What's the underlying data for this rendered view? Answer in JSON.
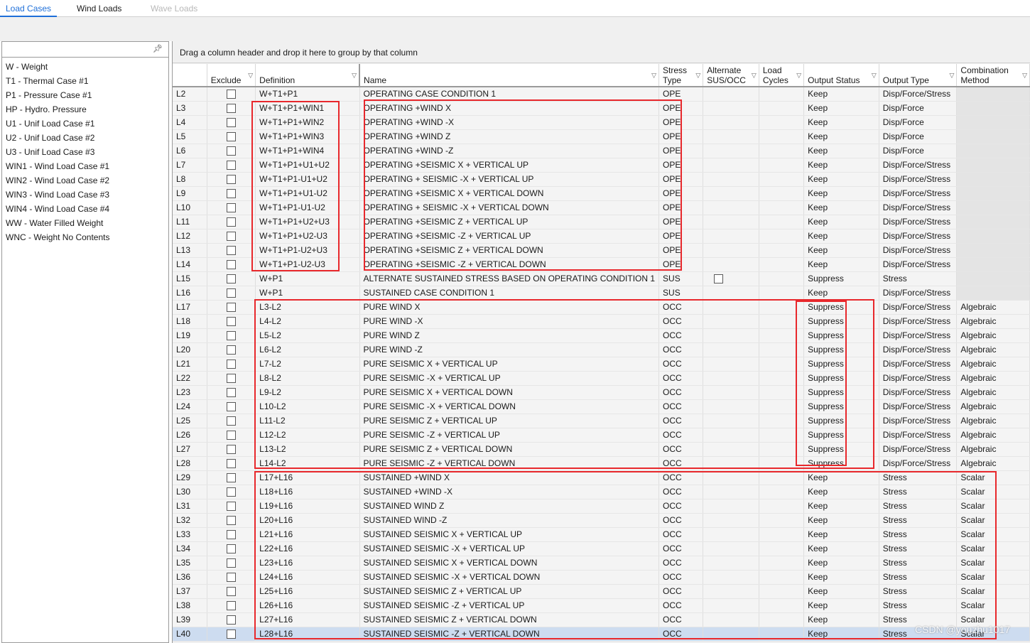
{
  "tabs": [
    {
      "label": "Load Cases",
      "state": "active"
    },
    {
      "label": "Wind Loads",
      "state": "normal"
    },
    {
      "label": "Wave Loads",
      "state": "disabled"
    }
  ],
  "left_list": [
    "W - Weight",
    "T1 - Thermal Case #1",
    "P1 - Pressure Case #1",
    "HP - Hydro. Pressure",
    "U1 - Unif Load Case #1",
    "U2 - Unif Load Case #2",
    "U3 - Unif Load Case #3",
    "WIN1 - Wind Load Case #1",
    "WIN2 - Wind Load Case #2",
    "WIN3 - Wind Load Case #3",
    "WIN4 - Wind Load Case #4",
    "WW - Water Filled Weight",
    "WNC - Weight No Contents"
  ],
  "group_panel": "Drag a column header and drop it here to group by that column",
  "columns": [
    {
      "key": "id",
      "label": "",
      "filter": false
    },
    {
      "key": "exclude",
      "label": "Exclude",
      "filter": true
    },
    {
      "key": "definition",
      "label": "Definition",
      "filter": true
    },
    {
      "key": "name",
      "label": "Name",
      "filter": true
    },
    {
      "key": "stress",
      "label": "Stress\nType",
      "filter": true
    },
    {
      "key": "alt",
      "label": "Alternate\nSUS/OCC",
      "filter": true
    },
    {
      "key": "cycles",
      "label": "Load\nCycles",
      "filter": true
    },
    {
      "key": "output",
      "label": "Output Status",
      "filter": true
    },
    {
      "key": "otype",
      "label": "Output Type",
      "filter": true
    },
    {
      "key": "comb",
      "label": "Combination\nMethod",
      "filter": true
    }
  ],
  "rows": [
    [
      "L2",
      "W+T1+P1",
      "OPERATING CASE CONDITION 1",
      "OPE",
      "Keep",
      "Disp/Force/Stress",
      ""
    ],
    [
      "L3",
      "W+T1+P1+WIN1",
      "OPERATING +WIND X",
      "OPE",
      "Keep",
      "Disp/Force",
      ""
    ],
    [
      "L4",
      "W+T1+P1+WIN2",
      "OPERATING +WIND -X",
      "OPE",
      "Keep",
      "Disp/Force",
      ""
    ],
    [
      "L5",
      "W+T1+P1+WIN3",
      "OPERATING +WIND Z",
      "OPE",
      "Keep",
      "Disp/Force",
      ""
    ],
    [
      "L6",
      "W+T1+P1+WIN4",
      "OPERATING +WIND -Z",
      "OPE",
      "Keep",
      "Disp/Force",
      ""
    ],
    [
      "L7",
      "W+T1+P1+U1+U2",
      "OPERATING +SEISMIC X + VERTICAL UP",
      "OPE",
      "Keep",
      "Disp/Force/Stress",
      ""
    ],
    [
      "L8",
      "W+T1+P1-U1+U2",
      "OPERATING + SEISMIC -X + VERTICAL UP",
      "OPE",
      "Keep",
      "Disp/Force/Stress",
      ""
    ],
    [
      "L9",
      "W+T1+P1+U1-U2",
      "OPERATING +SEISMIC X + VERTICAL DOWN",
      "OPE",
      "Keep",
      "Disp/Force/Stress",
      ""
    ],
    [
      "L10",
      "W+T1+P1-U1-U2",
      "OPERATING + SEISMIC -X + VERTICAL DOWN",
      "OPE",
      "Keep",
      "Disp/Force/Stress",
      ""
    ],
    [
      "L11",
      "W+T1+P1+U2+U3",
      "OPERATING +SEISMIC Z + VERTICAL UP",
      "OPE",
      "Keep",
      "Disp/Force/Stress",
      ""
    ],
    [
      "L12",
      "W+T1+P1+U2-U3",
      "OPERATING +SEISMIC -Z + VERTICAL UP",
      "OPE",
      "Keep",
      "Disp/Force/Stress",
      ""
    ],
    [
      "L13",
      "W+T1+P1-U2+U3",
      "OPERATING +SEISMIC Z + VERTICAL DOWN",
      "OPE",
      "Keep",
      "Disp/Force/Stress",
      ""
    ],
    [
      "L14",
      "W+T1+P1-U2-U3",
      "OPERATING +SEISMIC -Z + VERTICAL DOWN",
      "OPE",
      "Keep",
      "Disp/Force/Stress",
      ""
    ],
    [
      "L15",
      "W+P1",
      "ALTERNATE SUSTAINED STRESS BASED ON OPERATING CONDITION 1",
      "SUS",
      "Suppress",
      "Stress",
      ""
    ],
    [
      "L16",
      "W+P1",
      "SUSTAINED CASE CONDITION 1",
      "SUS",
      "Keep",
      "Disp/Force/Stress",
      ""
    ],
    [
      "L17",
      "L3-L2",
      "PURE WIND X",
      "OCC",
      "Suppress",
      "Disp/Force/Stress",
      "Algebraic"
    ],
    [
      "L18",
      "L4-L2",
      "PURE WIND -X",
      "OCC",
      "Suppress",
      "Disp/Force/Stress",
      "Algebraic"
    ],
    [
      "L19",
      "L5-L2",
      "PURE WIND Z",
      "OCC",
      "Suppress",
      "Disp/Force/Stress",
      "Algebraic"
    ],
    [
      "L20",
      "L6-L2",
      "PURE WIND -Z",
      "OCC",
      "Suppress",
      "Disp/Force/Stress",
      "Algebraic"
    ],
    [
      "L21",
      "L7-L2",
      "PURE SEISMIC X + VERTICAL UP",
      "OCC",
      "Suppress",
      "Disp/Force/Stress",
      "Algebraic"
    ],
    [
      "L22",
      "L8-L2",
      "PURE SEISMIC -X + VERTICAL UP",
      "OCC",
      "Suppress",
      "Disp/Force/Stress",
      "Algebraic"
    ],
    [
      "L23",
      "L9-L2",
      "PURE SEISMIC X + VERTICAL DOWN",
      "OCC",
      "Suppress",
      "Disp/Force/Stress",
      "Algebraic"
    ],
    [
      "L24",
      "L10-L2",
      "PURE SEISMIC -X + VERTICAL DOWN",
      "OCC",
      "Suppress",
      "Disp/Force/Stress",
      "Algebraic"
    ],
    [
      "L25",
      "L11-L2",
      "PURE SEISMIC Z + VERTICAL UP",
      "OCC",
      "Suppress",
      "Disp/Force/Stress",
      "Algebraic"
    ],
    [
      "L26",
      "L12-L2",
      "PURE SEISMIC -Z + VERTICAL UP",
      "OCC",
      "Suppress",
      "Disp/Force/Stress",
      "Algebraic"
    ],
    [
      "L27",
      "L13-L2",
      "PURE SEISMIC Z + VERTICAL DOWN",
      "OCC",
      "Suppress",
      "Disp/Force/Stress",
      "Algebraic"
    ],
    [
      "L28",
      "L14-L2",
      "PURE SEISMIC -Z + VERTICAL DOWN",
      "OCC",
      "Suppress",
      "Disp/Force/Stress",
      "Algebraic"
    ],
    [
      "L29",
      "L17+L16",
      "SUSTAINED +WIND X",
      "OCC",
      "Keep",
      "Stress",
      "Scalar"
    ],
    [
      "L30",
      "L18+L16",
      "SUSTAINED +WIND -X",
      "OCC",
      "Keep",
      "Stress",
      "Scalar"
    ],
    [
      "L31",
      "L19+L16",
      "SUSTAINED WIND Z",
      "OCC",
      "Keep",
      "Stress",
      "Scalar"
    ],
    [
      "L32",
      "L20+L16",
      "SUSTAINED WIND -Z",
      "OCC",
      "Keep",
      "Stress",
      "Scalar"
    ],
    [
      "L33",
      "L21+L16",
      "SUSTAINED SEISMIC X + VERTICAL UP",
      "OCC",
      "Keep",
      "Stress",
      "Scalar"
    ],
    [
      "L34",
      "L22+L16",
      "SUSTAINED SEISMIC -X + VERTICAL UP",
      "OCC",
      "Keep",
      "Stress",
      "Scalar"
    ],
    [
      "L35",
      "L23+L16",
      "SUSTAINED SEISMIC X + VERTICAL DOWN",
      "OCC",
      "Keep",
      "Stress",
      "Scalar"
    ],
    [
      "L36",
      "L24+L16",
      "SUSTAINED SEISMIC -X + VERTICAL DOWN",
      "OCC",
      "Keep",
      "Stress",
      "Scalar"
    ],
    [
      "L37",
      "L25+L16",
      "SUSTAINED SEISMIC Z + VERTICAL UP",
      "OCC",
      "Keep",
      "Stress",
      "Scalar"
    ],
    [
      "L38",
      "L26+L16",
      "SUSTAINED SEISMIC -Z + VERTICAL UP",
      "OCC",
      "Keep",
      "Stress",
      "Scalar"
    ],
    [
      "L39",
      "L27+L16",
      "SUSTAINED SEISMIC Z + VERTICAL DOWN",
      "OCC",
      "Keep",
      "Stress",
      "Scalar"
    ],
    [
      "L40",
      "L28+L16",
      "SUSTAINED SEISMIC -Z + VERTICAL DOWN",
      "OCC",
      "Keep",
      "Stress",
      "Scalar"
    ]
  ],
  "alt_checkbox_row": "L15",
  "selected_row": "L40",
  "colors": {
    "accent": "#1e6fd9",
    "highlight": "#e8282c",
    "selection": "#cddcf0"
  },
  "icons": {
    "pin": "pin-icon",
    "filter": "filter-icon"
  },
  "watermark": "CSDN @youzhu1017"
}
